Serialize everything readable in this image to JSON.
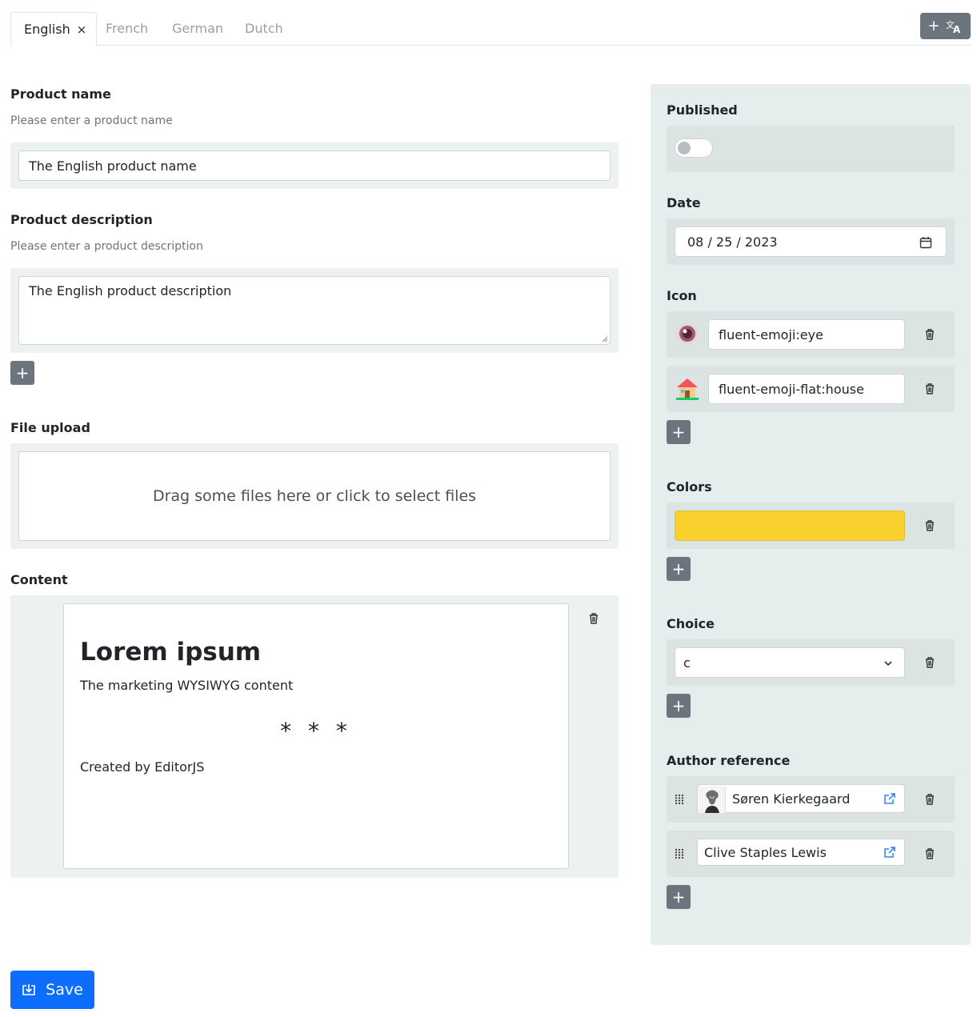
{
  "tabs": [
    {
      "label": "English",
      "close": "×"
    },
    {
      "label": "French"
    },
    {
      "label": "German"
    },
    {
      "label": "Dutch"
    }
  ],
  "tab_actions": {
    "add": "+",
    "translate_icon": "translate-icon"
  },
  "product_name": {
    "label": "Product name",
    "help": "Please enter a product name",
    "value": "The English product name"
  },
  "product_description": {
    "label": "Product description",
    "help": "Please enter a product description",
    "value": "The English product description",
    "add": "+"
  },
  "file_upload": {
    "label": "File upload",
    "dropzone_text": "Drag some files here or click to select files"
  },
  "content": {
    "label": "Content",
    "heading": "Lorem ipsum",
    "paragraph": "The marketing WYSIWYG content",
    "delimiter": "* * *",
    "footer": "Created by EditorJS"
  },
  "published": {
    "label": "Published",
    "checked": false
  },
  "date": {
    "label": "Date",
    "value": "08 / 25 / 2023"
  },
  "icon": {
    "label": "Icon",
    "items": [
      {
        "value": "fluent-emoji:eye",
        "icon": "eye-emoji-icon"
      },
      {
        "value": "fluent-emoji-flat:house",
        "icon": "house-emoji-icon"
      }
    ],
    "add": "+"
  },
  "colors": {
    "label": "Colors",
    "items": [
      {
        "value": "#f8d12e"
      }
    ],
    "add": "+"
  },
  "choice": {
    "label": "Choice",
    "items": [
      {
        "value": "c"
      }
    ],
    "add": "+"
  },
  "author_reference": {
    "label": "Author reference",
    "items": [
      {
        "name": "Søren Kierkegaard",
        "has_avatar": true
      },
      {
        "name": "Clive Staples Lewis",
        "has_avatar": false
      }
    ],
    "add": "+"
  },
  "save": {
    "label": "Save"
  },
  "colors_theme": {
    "primary": "#0d6efd",
    "secondary": "#6c757d",
    "panel": "#e5eded"
  }
}
